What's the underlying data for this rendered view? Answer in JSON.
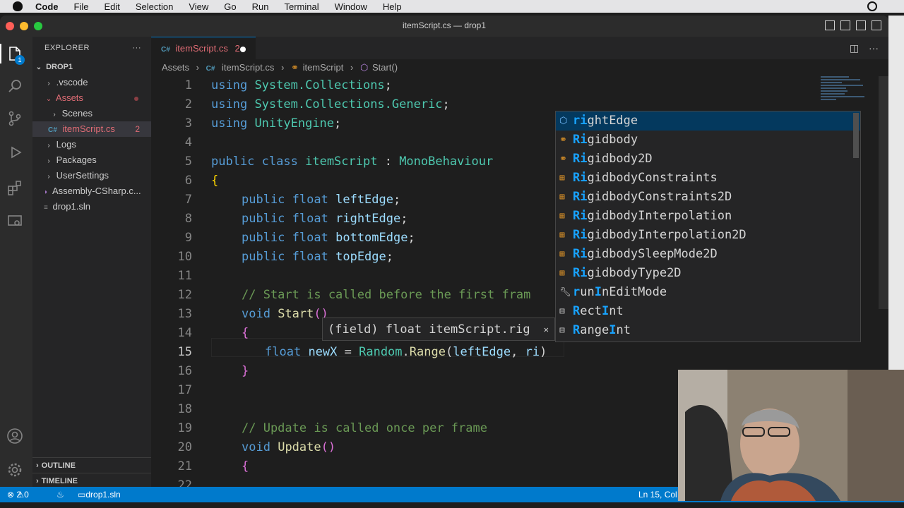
{
  "menubar": {
    "app": "Code",
    "items": [
      "File",
      "Edit",
      "Selection",
      "View",
      "Go",
      "Run",
      "Terminal",
      "Window",
      "Help"
    ]
  },
  "window": {
    "title": "itemScript.cs — drop1"
  },
  "sidebar": {
    "title": "EXPLORER",
    "root": "DROP1",
    "items": [
      {
        "label": ".vscode",
        "kind": "folder"
      },
      {
        "label": "Assets",
        "kind": "folder-open"
      },
      {
        "label": "Scenes",
        "kind": "folder"
      },
      {
        "label": "itemScript.cs",
        "kind": "file",
        "badge": "2"
      },
      {
        "label": "Logs",
        "kind": "folder"
      },
      {
        "label": "Packages",
        "kind": "folder"
      },
      {
        "label": "UserSettings",
        "kind": "folder"
      },
      {
        "label": "Assembly-CSharp.c...",
        "kind": "file"
      },
      {
        "label": "drop1.sln",
        "kind": "file"
      }
    ],
    "outline": "OUTLINE",
    "timeline": "TIMELINE"
  },
  "tab": {
    "label": "itemScript.cs",
    "badge": "2"
  },
  "breadcrumb": [
    "Assets",
    "itemScript.cs",
    "itemScript",
    "Start()"
  ],
  "lines": [
    "1",
    "2",
    "3",
    "4",
    "5",
    "6",
    "7",
    "8",
    "9",
    "10",
    "11",
    "12",
    "13",
    "14",
    "15",
    "16",
    "17",
    "18",
    "19",
    "20",
    "21",
    "22"
  ],
  "code": {
    "l1": "using System.Collections;",
    "l2": "using System.Collections.Generic;",
    "l3": "using UnityEngine;",
    "l5": "public class itemScript : MonoBehaviour",
    "l6": "{",
    "l7": "public float leftEdge;",
    "l8": "public float rightEdge;",
    "l9": "public float bottomEdge;",
    "l10": "public float topEdge;",
    "l12": "// Start is called before the first fram",
    "l13": "void Start()",
    "l14": "{",
    "l15": "float newX = Random.Range(leftEdge, ri)",
    "l16": "}",
    "l19": "// Update is called once per frame",
    "l20": "void Update()",
    "l21": "{"
  },
  "suggestions": [
    {
      "match": "ri",
      "rest": "ghtEdge",
      "icon": "field"
    },
    {
      "match": "Ri",
      "rest": "gidbody",
      "icon": "class"
    },
    {
      "match": "Ri",
      "rest": "gidbody2D",
      "icon": "class"
    },
    {
      "match": "Ri",
      "rest": "gidbodyConstraints",
      "icon": "enum"
    },
    {
      "match": "Ri",
      "rest": "gidbodyConstraints2D",
      "icon": "enum"
    },
    {
      "match": "Ri",
      "rest": "gidbodyInterpolation",
      "icon": "enum"
    },
    {
      "match": "Ri",
      "rest": "gidbodyInterpolation2D",
      "icon": "enum"
    },
    {
      "match": "Ri",
      "rest": "gidbodySleepMode2D",
      "icon": "enum"
    },
    {
      "match": "Ri",
      "rest": "gidbodyType2D",
      "icon": "enum"
    },
    {
      "match": "r",
      "rest": "un",
      "match2": "I",
      "rest2": "nEditMode",
      "icon": "wrench"
    },
    {
      "match": "R",
      "rest": "ect",
      "match2": "I",
      "rest2": "nt",
      "icon": "struct"
    },
    {
      "match": "R",
      "rest": "ange",
      "match2": "I",
      "rest2": "nt",
      "icon": "struct"
    }
  ],
  "hover": {
    "text": "(field) float itemScript.rig"
  },
  "status": {
    "problems": "2",
    "warnings": "0",
    "solution": "drop1.sln",
    "position": "Ln 15, Col"
  },
  "colors": {
    "accent": "#007acc",
    "selection": "#04395e",
    "match": "#18a3ff"
  }
}
